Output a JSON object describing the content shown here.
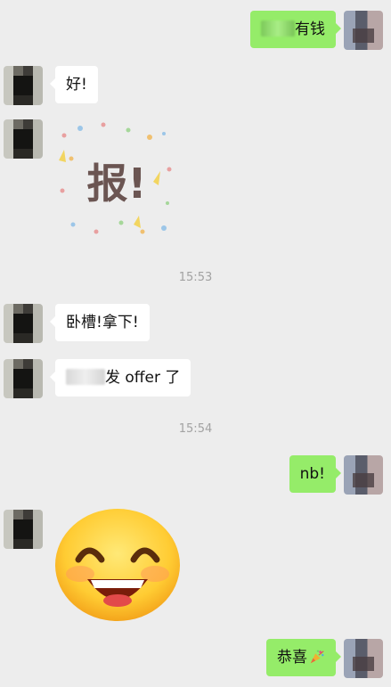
{
  "messages": [
    {
      "side": "right",
      "text": "有钱",
      "redacted_prefix": true
    },
    {
      "side": "left",
      "text": "好!"
    },
    {
      "side": "left",
      "sticker": "bao-sticker",
      "sticker_text": "报!"
    },
    {
      "time": "15:53"
    },
    {
      "side": "left",
      "text": "卧槽!拿下!"
    },
    {
      "side": "left",
      "text": "发 offer 了",
      "redacted_prefix": true
    },
    {
      "time": "15:54"
    },
    {
      "side": "right",
      "text": "nb!"
    },
    {
      "side": "left",
      "sticker": "laughing-emoji"
    },
    {
      "side": "right",
      "text": "恭喜",
      "icon": "party-popper-icon"
    }
  ],
  "colors": {
    "background": "#ededed",
    "incoming_bubble": "#ffffff",
    "outgoing_bubble": "#95ec69",
    "timestamp": "#a2a2a2"
  }
}
